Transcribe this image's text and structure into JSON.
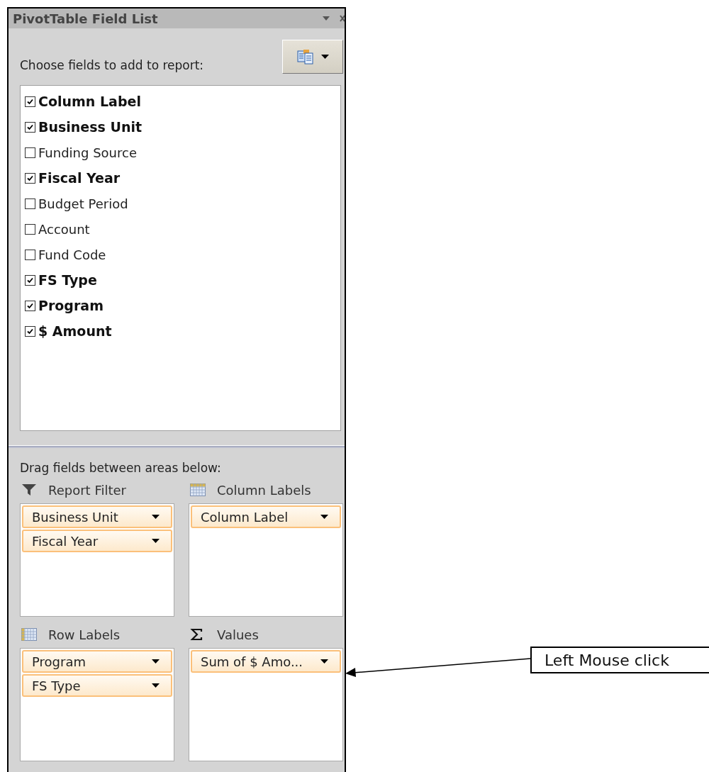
{
  "panel": {
    "title": "PivotTable Field List",
    "prompt": "Choose fields to add to report:",
    "fields": [
      {
        "label": "Column Label",
        "checked": true
      },
      {
        "label": "Business Unit",
        "checked": true
      },
      {
        "label": "Funding Source",
        "checked": false
      },
      {
        "label": "Fiscal Year",
        "checked": true
      },
      {
        "label": "Budget Period",
        "checked": false
      },
      {
        "label": "Account",
        "checked": false
      },
      {
        "label": "Fund Code",
        "checked": false
      },
      {
        "label": "FS Type",
        "checked": true
      },
      {
        "label": "Program",
        "checked": true
      },
      {
        "label": "$ Amount",
        "checked": true
      }
    ],
    "areas_prompt": "Drag fields between areas below:",
    "areas": [
      {
        "kind": "filter",
        "title": "Report Filter",
        "items": [
          "Business Unit",
          "Fiscal Year"
        ]
      },
      {
        "kind": "columns",
        "title": "Column Labels",
        "items": [
          "Column Label"
        ]
      },
      {
        "kind": "rows",
        "title": "Row Labels",
        "items": [
          "Program",
          "FS Type"
        ]
      },
      {
        "kind": "values",
        "title": "Values",
        "items": [
          "Sum of $ Amo..."
        ]
      }
    ]
  },
  "callout": {
    "text": "Left Mouse click"
  }
}
